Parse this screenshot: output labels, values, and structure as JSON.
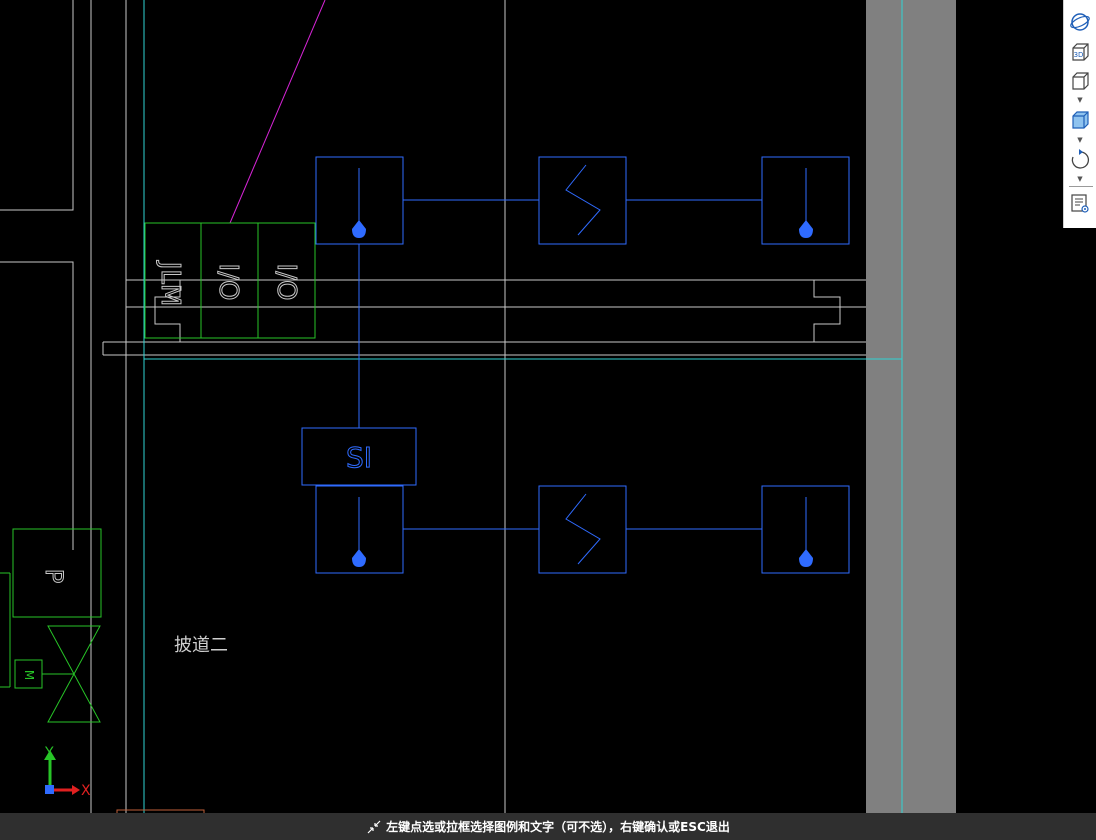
{
  "drawing": {
    "labels": {
      "jlm": "JLM",
      "io_1": "I/O",
      "io_2": "I/O",
      "si": "SI",
      "p": "P",
      "m": "M",
      "area": "披道二"
    }
  },
  "ucs": {
    "y_label": "Y",
    "x_label": "X"
  },
  "toolbar": {
    "items": [
      {
        "icon": "orbit-icon"
      },
      {
        "icon": "view-3d-icon",
        "text": "3D"
      },
      {
        "icon": "view-cube-icon"
      },
      {
        "icon": "visual-style-icon"
      },
      {
        "icon": "rotate-icon"
      },
      {
        "icon": "layer-list-icon"
      }
    ]
  },
  "status": {
    "message": "左键点选或拉框选择图例和文字（可不选），右键确认或ESC退出"
  },
  "colors": {
    "background": "#000000",
    "blue": "#2f6bff",
    "green": "#27c427",
    "cyan": "#2fd3d3",
    "magenta": "#d624d6",
    "gray_band": "#808080",
    "line_gray": "#c8c8c8"
  }
}
